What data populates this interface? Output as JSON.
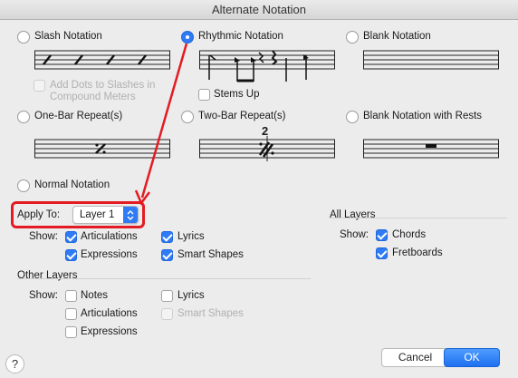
{
  "window": {
    "title": "Alternate Notation"
  },
  "notation_options": {
    "slash": "Slash Notation",
    "rhythmic": "Rhythmic Notation",
    "blank": "Blank Notation",
    "add_dots_line1": "Add Dots to Slashes in",
    "add_dots_line2": "Compound Meters",
    "stems_up": "Stems Up",
    "one_bar_repeat": "One-Bar Repeat(s)",
    "two_bar_repeat": "Two-Bar Repeat(s)",
    "two_bar_number": "2",
    "blank_rests": "Blank Notation with Rests",
    "normal": "Normal Notation",
    "selected": "Rhythmic Notation"
  },
  "apply_to": {
    "label": "Apply To:",
    "value": "Layer 1"
  },
  "show": {
    "label": "Show:",
    "articulations": "Articulations",
    "expressions": "Expressions",
    "lyrics": "Lyrics",
    "smart_shapes": "Smart Shapes"
  },
  "other_layers": {
    "heading": "Other Layers",
    "show_label": "Show:",
    "notes": "Notes",
    "articulations": "Articulations",
    "expressions": "Expressions",
    "lyrics": "Lyrics",
    "smart_shapes": "Smart Shapes"
  },
  "all_layers": {
    "heading": "All Layers",
    "show_label": "Show:",
    "chords": "Chords",
    "fretboards": "Fretboards"
  },
  "buttons": {
    "cancel": "Cancel",
    "ok": "OK",
    "help": "?"
  },
  "colors": {
    "accent": "#2f7bf5",
    "annotation": "#e31b23",
    "background": "#ececec"
  }
}
